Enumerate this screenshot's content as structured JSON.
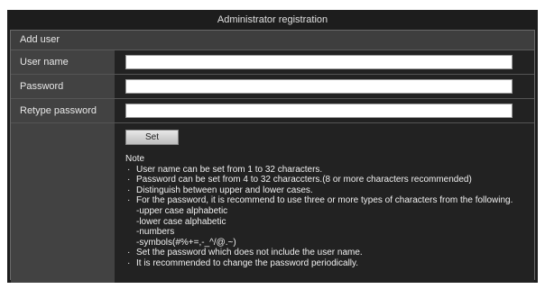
{
  "window": {
    "title": "Administrator registration"
  },
  "section": {
    "header": "Add user"
  },
  "fields": [
    {
      "label": "User name",
      "value": ""
    },
    {
      "label": "Password",
      "value": ""
    },
    {
      "label": "Retype password",
      "value": ""
    }
  ],
  "actions": {
    "set_label": "Set"
  },
  "note": {
    "title": "Note",
    "items": [
      "User name can be set from 1 to 32 characters.",
      "Password can be set from 4 to 32 characcters.(8 or more characters recommended)",
      "Distinguish between upper and lower cases.",
      "For the password, it is recommend to use three or more types of characters from the following.",
      "-upper case alphabetic",
      "-lower case alphabetic",
      "-numbers",
      "-symbols(#%+=,-_^/@.~)",
      "Set the password which does not include the user name.",
      "It is recommended to change the password periodically."
    ]
  },
  "colors": {
    "panel": "#1d1d1d",
    "label_bg": "#424242",
    "value_bg": "#222222",
    "header_bg": "#3e3e3e"
  }
}
